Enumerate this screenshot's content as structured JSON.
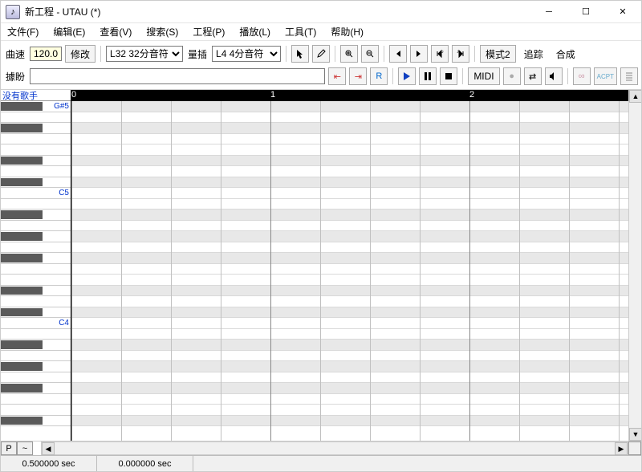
{
  "title": "新工程 - UTAU (*)",
  "menu": [
    "文件(F)",
    "编辑(E)",
    "查看(V)",
    "搜索(S)",
    "工程(P)",
    "播放(L)",
    "工具(T)",
    "帮助(H)"
  ],
  "toolbar": {
    "tempo_label": "曲速",
    "tempo_value": "120.0",
    "modify_button": "修改",
    "quant_options": [
      "L32 32分音符"
    ],
    "quant_selected": "L32 32分音符",
    "insert_label": "量插",
    "length_options": [
      "L4 4分音符"
    ],
    "length_selected": "L4 4分音符",
    "mode_button": "模式2",
    "trace_button": "追踪",
    "synth_button": "合成",
    "lyric_label": "據盼",
    "midi_button": "MIDI",
    "acpt_button": "ACPT"
  },
  "singer_label": "没有歌手",
  "ruler_marks": [
    {
      "pos": 0,
      "label": "0"
    },
    {
      "pos": 248,
      "label": "1"
    },
    {
      "pos": 496,
      "label": "2"
    }
  ],
  "note_labels": {
    "top": "G#5",
    "mid1": "C5",
    "mid2": "C4"
  },
  "piano_pattern": [
    "w",
    "b",
    "w",
    "b",
    "w",
    "w",
    "b",
    "w",
    "b",
    "w",
    "b",
    "w"
  ],
  "status": {
    "cell1": "0.500000 sec",
    "cell2": "0.000000 sec"
  },
  "bottom": {
    "p_label": "P",
    "tilde_label": "~"
  }
}
